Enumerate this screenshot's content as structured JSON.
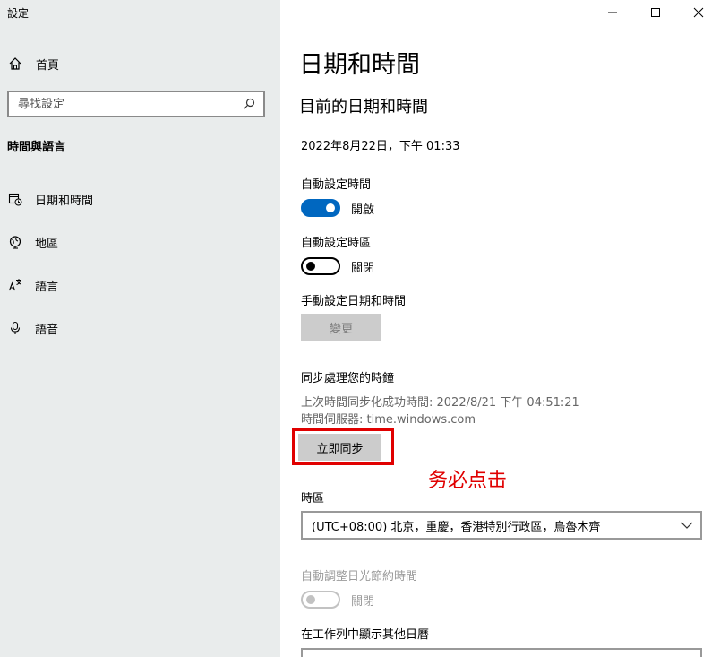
{
  "window": {
    "title": "設定"
  },
  "sidebar": {
    "home_label": "首頁",
    "search_placeholder": "尋找設定",
    "section_title": "時間與語言",
    "items": [
      {
        "label": "日期和時間",
        "icon": "calendar-clock-icon"
      },
      {
        "label": "地區",
        "icon": "globe-icon"
      },
      {
        "label": "語言",
        "icon": "language-icon"
      },
      {
        "label": "語音",
        "icon": "microphone-icon"
      }
    ]
  },
  "main": {
    "page_title": "日期和時間",
    "sub_title": "目前的日期和時間",
    "current_datetime": "2022年8月22日，下午 01:33",
    "auto_time": {
      "label": "自動設定時間",
      "state": "開啟",
      "on": true
    },
    "auto_timezone": {
      "label": "自動設定時區",
      "state": "關閉",
      "on": false
    },
    "manual": {
      "label": "手動設定日期和時間",
      "button": "變更"
    },
    "sync": {
      "label": "同步處理您的時鐘",
      "last_sync": "上次時間同步化成功時間: 2022/8/21 下午 04:51:21",
      "server": "時間伺服器: time.windows.com",
      "button": "立即同步"
    },
    "annotation": "务必点击",
    "timezone": {
      "label": "時區",
      "value": "(UTC+08:00) 北京，重慶，香港特別行政區，烏魯木齊"
    },
    "dst": {
      "label": "自動調整日光節約時間",
      "state": "關閉",
      "on": false
    },
    "calendar": {
      "label": "在工作列中顯示其他日曆"
    }
  },
  "colors": {
    "accent": "#0067c0",
    "annotation": "#e00000",
    "sidebar_bg": "#e9ecec"
  }
}
